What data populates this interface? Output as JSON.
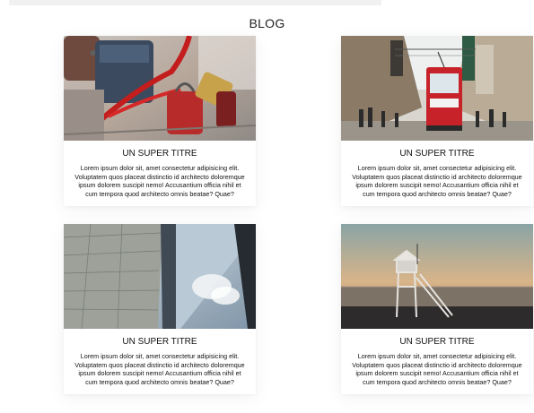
{
  "page": {
    "title": "BLOG"
  },
  "cards": [
    {
      "image": "padlocks-photo",
      "title": "UN SUPER TITRE",
      "text": "Lorem ipsum dolor sit, amet consectetur adipisicing elit. Voluptatem quos placeat distinctio id architecto doloremque ipsum dolorem suscipit nemo! Accusantium officia nihil et cum tempora quod architecto omnis beatae? Quae?"
    },
    {
      "image": "tram-street-photo",
      "title": "UN SUPER TITRE",
      "text": "Lorem ipsum dolor sit, amet consectetur adipisicing elit. Voluptatem quos placeat distinctio id architecto doloremque ipsum dolorem suscipit nemo! Accusantium officia nihil et cum tempora quod architecto omnis beatae? Quae?"
    },
    {
      "image": "sail-photo",
      "title": "UN SUPER TITRE",
      "text": "Lorem ipsum dolor sit, amet consectetur adipisicing elit. Voluptatem quos placeat distinctio id architecto doloremque ipsum dolorem suscipit nemo! Accusantium officia nihil et cum tempora quod architecto omnis beatae? Quae?"
    },
    {
      "image": "lifeguard-tower-photo",
      "title": "UN SUPER TITRE",
      "text": "Lorem ipsum dolor sit, amet consectetur adipisicing elit. Voluptatem quos placeat distinctio id architecto doloremque ipsum dolorem suscipit nemo! Accusantium officia nihil et cum tempora quod architecto omnis beatae? Quae?"
    }
  ]
}
